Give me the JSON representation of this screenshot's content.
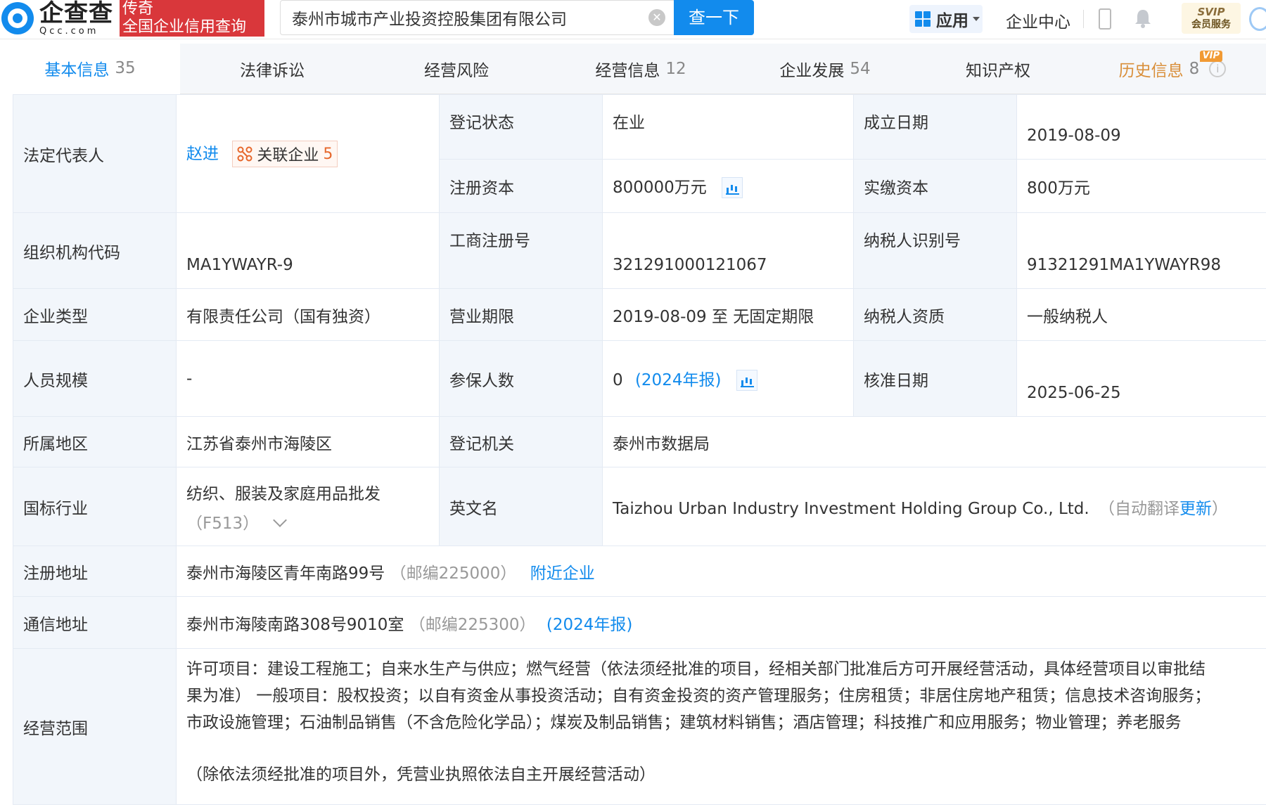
{
  "header": {
    "logo_cn": "企查查",
    "logo_en": "Qcc.com",
    "promo_line1": "传奇",
    "promo_line2": "全国企业信用查询",
    "search_value": "泰州市城市产业投资控股集团有限公司",
    "search_button": "查一下",
    "apps_label": "应用",
    "enterprise_center": "企业中心",
    "svip_line1": "SVIP",
    "svip_line2": "会员服务"
  },
  "tabs": [
    {
      "label": "基本信息",
      "count": "35"
    },
    {
      "label": "法律诉讼",
      "count": ""
    },
    {
      "label": "经营风险",
      "count": ""
    },
    {
      "label": "经营信息",
      "count": "12"
    },
    {
      "label": "企业发展",
      "count": "54"
    },
    {
      "label": "知识产权",
      "count": ""
    },
    {
      "label": "历史信息",
      "count": "8",
      "badge": "VIP"
    }
  ],
  "info": {
    "legal_rep": {
      "label": "法定代表人",
      "name": "赵进",
      "related_label": "关联企业",
      "related_count": "5"
    },
    "reg_status": {
      "label": "登记状态",
      "value": "在业"
    },
    "found_date": {
      "label": "成立日期",
      "value": "2019-08-09"
    },
    "reg_capital": {
      "label": "注册资本",
      "value": "800000万元"
    },
    "paid_capital": {
      "label": "实缴资本",
      "value": "800万元"
    },
    "org_code": {
      "label": "组织机构代码",
      "value": "MA1YWAYR-9"
    },
    "biz_reg_no": {
      "label": "工商注册号",
      "value": "321291000121067"
    },
    "taxpayer_id": {
      "label": "纳税人识别号",
      "value": "91321291MA1YWAYR98"
    },
    "ent_type": {
      "label": "企业类型",
      "value": "有限责任公司（国有独资）"
    },
    "biz_term": {
      "label": "营业期限",
      "value": "2019-08-09 至 无固定期限"
    },
    "taxpayer_qual": {
      "label": "纳税人资质",
      "value": "一般纳税人"
    },
    "staff_size": {
      "label": "人员规模",
      "value": "-"
    },
    "insured": {
      "label": "参保人数",
      "value": "0",
      "report": "(2024年报)"
    },
    "approve_date": {
      "label": "核准日期",
      "value": "2025-06-25"
    },
    "region": {
      "label": "所属地区",
      "value": "江苏省泰州市海陵区"
    },
    "reg_authority": {
      "label": "登记机关",
      "value": "泰州市数据局"
    },
    "industry": {
      "label": "国标行业",
      "value": "纺织、服装及家庭用品批发",
      "code": "（F513）"
    },
    "english_name": {
      "label": "英文名",
      "value": "Taizhou Urban Industry Investment Holding Group Co., Ltd.",
      "note_prefix": "（自动翻译",
      "note_link": "更新",
      "note_suffix": "）"
    },
    "reg_address": {
      "label": "注册地址",
      "value": "泰州市海陵区青年南路99号",
      "postcode": "（邮编225000）",
      "nearby": "附近企业"
    },
    "mail_address": {
      "label": "通信地址",
      "value": "泰州市海陵南路308号9010室",
      "postcode": "（邮编225300）",
      "report": "(2024年报)"
    },
    "scope": {
      "label": "经营范围",
      "line1": "许可项目：建设工程施工；自来水生产与供应；燃气经营（依法须经批准的项目，经相关部门批准后方可开展经营活动，具体经营项目以审批结",
      "line2": "果为准） 一般项目：股权投资；以自有资金从事投资活动；自有资金投资的资产管理服务；住房租赁；非居住房地产租赁；信息技术咨询服务；",
      "line3": "市政设施管理；石油制品销售（不含危险化学品）；煤炭及制品销售；建筑材料销售；酒店管理；科技推广和应用服务；物业管理；养老服务",
      "line4": "（除依法须经批准的项目外，凭营业执照依法自主开展经营活动）"
    }
  },
  "colors": {
    "brand": "#128bed",
    "promo": "#d9373b",
    "label_bg": "#f2f6fb",
    "history": "#d98f3a"
  }
}
